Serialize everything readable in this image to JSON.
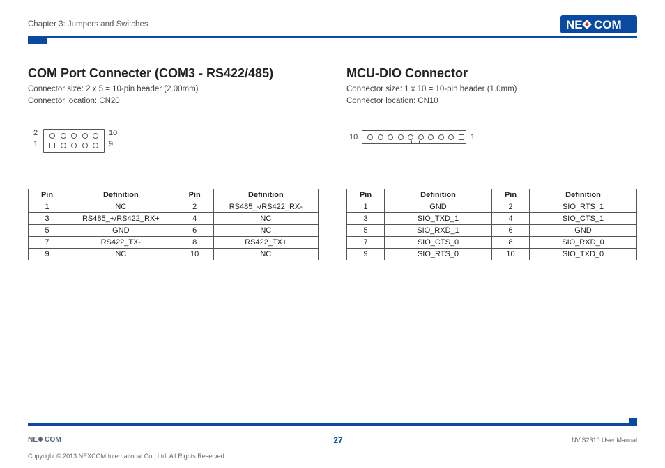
{
  "header": {
    "chapter": "Chapter 3: Jumpers and Switches",
    "brand_left": "NE",
    "brand_right": "COM"
  },
  "left": {
    "title": "COM Port Connecter (COM3 - RS422/485)",
    "size_line": "Connector size: 2 x 5 = 10-pin header (2.00mm)",
    "loc_line": "Connector location: CN20",
    "diagram": {
      "top_left": "2",
      "bot_left": "1",
      "top_right": "10",
      "bot_right": "9"
    },
    "table": {
      "headers": {
        "pin": "Pin",
        "def": "Definition"
      },
      "rows": [
        {
          "p1": "1",
          "d1": "NC",
          "p2": "2",
          "d2": "RS485_-/RS422_RX-"
        },
        {
          "p1": "3",
          "d1": "RS485_+/RS422_RX+",
          "p2": "4",
          "d2": "NC"
        },
        {
          "p1": "5",
          "d1": "GND",
          "p2": "6",
          "d2": "NC"
        },
        {
          "p1": "7",
          "d1": "RS422_TX-",
          "p2": "8",
          "d2": "RS422_TX+"
        },
        {
          "p1": "9",
          "d1": "NC",
          "p2": "10",
          "d2": "NC"
        }
      ]
    }
  },
  "right": {
    "title": "MCU-DIO Connector",
    "size_line": "Connector size: 1 x 10 = 10-pin header (1.0mm)",
    "loc_line": "Connector location: CN10",
    "diagram": {
      "left": "10",
      "right": "1"
    },
    "table": {
      "headers": {
        "pin": "Pin",
        "def": "Definition"
      },
      "rows": [
        {
          "p1": "1",
          "d1": "GND",
          "p2": "2",
          "d2": "SIO_RTS_1"
        },
        {
          "p1": "3",
          "d1": "SIO_TXD_1",
          "p2": "4",
          "d2": "SIO_CTS_1"
        },
        {
          "p1": "5",
          "d1": "SIO_RXD_1",
          "p2": "6",
          "d2": "GND"
        },
        {
          "p1": "7",
          "d1": "SIO_CTS_0",
          "p2": "8",
          "d2": "SIO_RXD_0"
        },
        {
          "p1": "9",
          "d1": "SIO_RTS_0",
          "p2": "10",
          "d2": "SIO_TXD_0"
        }
      ]
    }
  },
  "footer": {
    "copyright": "Copyright © 2013 NEXCOM International Co., Ltd. All Rights Reserved.",
    "page": "27",
    "manual": "NViS2310 User Manual"
  }
}
